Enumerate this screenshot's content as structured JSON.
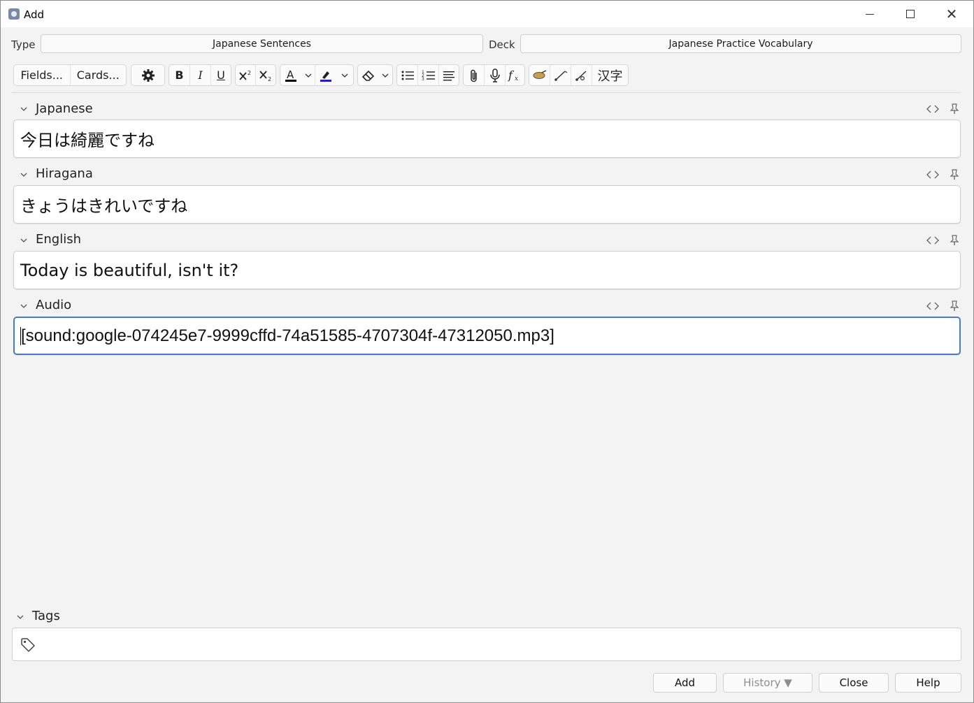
{
  "window": {
    "title": "Add",
    "close_glyph": "✕"
  },
  "note_type": {
    "label": "Type",
    "value": "Japanese Sentences"
  },
  "deck": {
    "label": "Deck",
    "value": "Japanese Practice Vocabulary"
  },
  "toolbar": {
    "fields_label": "Fields...",
    "cards_label": "Cards...",
    "bold_label": "B",
    "italic_label": "I",
    "underline_label": "U",
    "text_color": "#000000",
    "highlight_color": "#2020c8",
    "kanji_label": "汉字",
    "icons": [
      "gear-icon",
      "bold-icon",
      "italic-icon",
      "underline-icon",
      "superscript-icon",
      "subscript-icon",
      "text-color-icon",
      "highlight-icon",
      "eraser-icon",
      "bullet-list-icon",
      "numbered-list-icon",
      "align-icon",
      "paperclip-icon",
      "microphone-icon",
      "function-icon",
      "brush-icon",
      "furigana-add-icon",
      "furigana-remove-icon"
    ]
  },
  "fields": [
    {
      "name": "Japanese",
      "value": "今日は綺麗ですね"
    },
    {
      "name": "Hiragana",
      "value": "きょうはきれいですね"
    },
    {
      "name": "English",
      "value": "Today is beautiful, isn't it?"
    },
    {
      "name": "Audio",
      "value": "[sound:google-074245e7-9999cffd-74a51585-4707304f-47312050.mp3]"
    }
  ],
  "tags": {
    "label": "Tags",
    "value": ""
  },
  "buttons": {
    "add": "Add",
    "history": "History ▼",
    "close": "Close",
    "help": "Help"
  },
  "colors": {
    "focus_border": "#4d7bb7",
    "background": "#f3f3f3"
  }
}
